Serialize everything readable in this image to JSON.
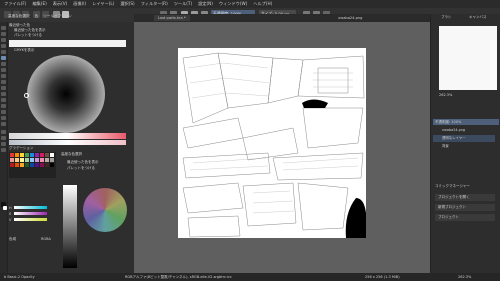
{
  "menubar": {
    "items": [
      "ファイル(F)",
      "編集(E)",
      "表示(V)",
      "画像(I)",
      "レイヤー(L)",
      "選択(S)",
      "フィルター(R)",
      "ツール(T)",
      "設定(N)",
      "ウィンドウ(W)",
      "ヘルプ(H)"
    ]
  },
  "toolbar": {
    "blend_mode": "不透明度: 100%",
    "size": "サイズ: 5.00 px"
  },
  "left_docker": {
    "tabs": [
      "高度な色選択",
      "色",
      "ツールオプション"
    ],
    "color_label": "最近使った色",
    "gradient_label": "グラデーション",
    "options": [
      "最近使った色を表示",
      "パレットをつける",
      "CMYKを表示"
    ],
    "hsv_labels": [
      "H",
      "S",
      "V"
    ],
    "percent": "25%",
    "bottom_label": "色域",
    "bottom_value": "RGBA"
  },
  "canvas": {
    "tabs": [
      "Lost parts.kra *",
      "uwaba24.png"
    ],
    "colors": {
      "bg": "#5f5f5f",
      "paper": "#ffffff"
    }
  },
  "right_docker": {
    "tabs": [
      "ブラシ",
      "キャンバス"
    ],
    "zoom": "262.3%",
    "blend": "不透明度: 100%",
    "layers": [
      "uwaba24.png",
      "透明なレイヤー",
      "背景"
    ],
    "section": "コミックマネージャー",
    "buttons": [
      "プロジェクトを開く",
      "新規プロジェクト",
      "プロジェクト"
    ]
  },
  "statusbar": {
    "left": "b Basic-2 Opacity",
    "middle": "RGBアルファ(8ビット整数/チャンネル), sRGB-elle-V2-srgbtrc.icc",
    "dims": "256 x 256 (1.3 MiB)",
    "zoom": "262.3%"
  }
}
